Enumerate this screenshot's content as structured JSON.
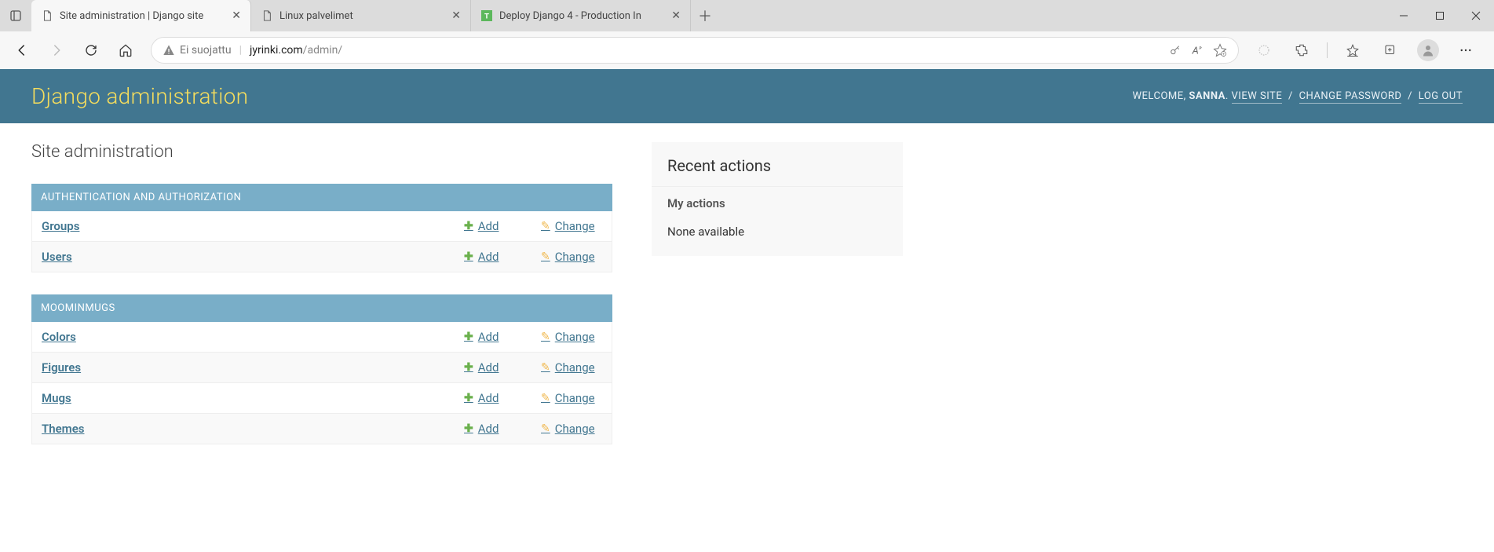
{
  "browser": {
    "tabs": [
      {
        "title": "Site administration | Django site",
        "favicon": "page"
      },
      {
        "title": "Linux palvelimet",
        "favicon": "page"
      },
      {
        "title": "Deploy Django 4 - Production In",
        "favicon": "t-green"
      }
    ],
    "address": {
      "security_label": "Ei suojattu",
      "host": "jyrinki.com",
      "path": "/admin/"
    }
  },
  "django": {
    "brand": "Django administration",
    "user": {
      "welcome": "WELCOME,",
      "name": "SANNA",
      "view_site": "VIEW SITE",
      "change_password": "CHANGE PASSWORD",
      "logout": "LOG OUT"
    },
    "page_title": "Site administration",
    "add_label": "Add",
    "change_label": "Change",
    "apps": [
      {
        "name": "AUTHENTICATION AND AUTHORIZATION",
        "models": [
          {
            "name": "Groups"
          },
          {
            "name": "Users"
          }
        ]
      },
      {
        "name": "MOOMINMUGS",
        "models": [
          {
            "name": "Colors"
          },
          {
            "name": "Figures"
          },
          {
            "name": "Mugs"
          },
          {
            "name": "Themes"
          }
        ]
      }
    ],
    "recent": {
      "title": "Recent actions",
      "subtitle": "My actions",
      "empty": "None available"
    }
  }
}
